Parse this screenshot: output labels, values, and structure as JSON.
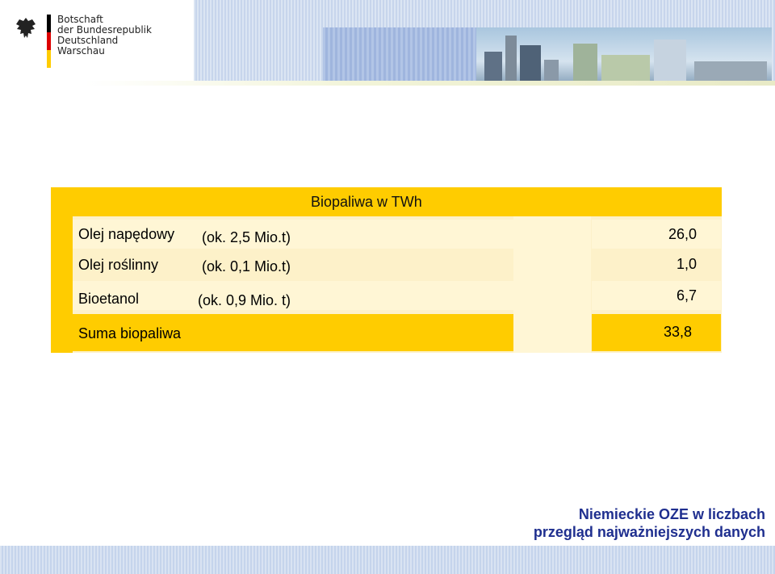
{
  "header": {
    "org_line1": "Botschaft",
    "org_line2": "der Bundesrepublik Deutschland",
    "org_line3": "Warschau",
    "flag_colors": [
      "#000000",
      "#dd0000",
      "#ffcc00"
    ],
    "emblem_icon": "federal-eagle-icon"
  },
  "table": {
    "title": "Biopaliwa w TWh",
    "rows": [
      {
        "label": "Olej napędowy",
        "note": "(ok. 2,5 Mio.t)",
        "value": "26,0"
      },
      {
        "label": "Olej roślinny",
        "note": "(ok. 0,1 Mio.t)",
        "value": "1,0"
      },
      {
        "label": "Bioetanol",
        "note": "(ok. 0,9 Mio. t)",
        "value": "6,7"
      },
      {
        "label": "Suma biopaliwa",
        "note": "",
        "value": "33,8"
      }
    ],
    "colors": {
      "accent": "#ffcc00",
      "light": "#fdf1c9",
      "lighter": "#fff8dc"
    }
  },
  "footer": {
    "title_line1": "Niemieckie OZE w liczbach",
    "title_line2": "przegląd najważniejszych danych",
    "title_color": "#1f2f8f"
  }
}
